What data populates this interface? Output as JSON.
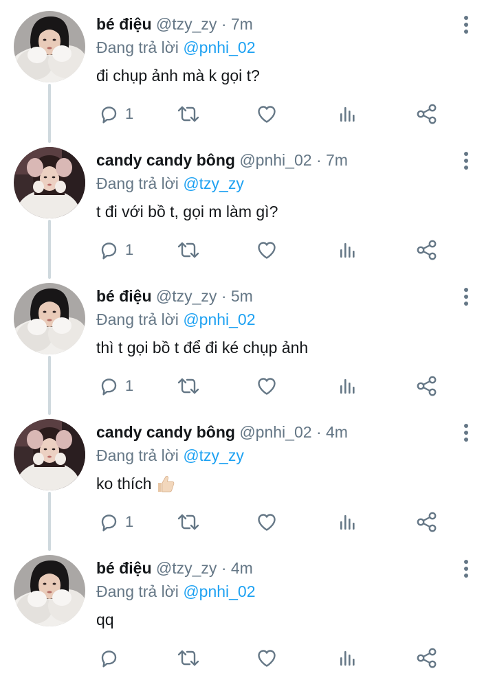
{
  "reply_prefix": "Đang trả lời",
  "tweets": [
    {
      "name": "bé điệu",
      "handle": "@tzy_zy",
      "dot": "·",
      "time": "7m",
      "reply_to": "@pnhi_02",
      "text": "đi chụp ảnh mà k gọi t?",
      "reply_count": "1",
      "avatar": "fur-girl",
      "emoji": ""
    },
    {
      "name": "candy candy bông",
      "handle": "@pnhi_02",
      "dot": "·",
      "time": "7m",
      "reply_to": "@tzy_zy",
      "text": "t đi với bồ t, gọi m làm gì?",
      "reply_count": "1",
      "avatar": "hoodie-girl",
      "emoji": ""
    },
    {
      "name": "bé điệu",
      "handle": "@tzy_zy",
      "dot": "·",
      "time": "5m",
      "reply_to": "@pnhi_02",
      "text": "thì t gọi bồ t để đi ké chụp ảnh",
      "reply_count": "1",
      "avatar": "fur-girl",
      "emoji": ""
    },
    {
      "name": "candy candy bông",
      "handle": "@pnhi_02",
      "dot": "·",
      "time": "4m",
      "reply_to": "@tzy_zy",
      "text": "ko thích",
      "reply_count": "1",
      "avatar": "hoodie-girl",
      "emoji": "thumbs-up"
    },
    {
      "name": "bé điệu",
      "handle": "@tzy_zy",
      "dot": "·",
      "time": "4m",
      "reply_to": "@pnhi_02",
      "text": "qq",
      "reply_count": "",
      "avatar": "fur-girl",
      "emoji": ""
    }
  ],
  "icons": {
    "reply": "reply-icon",
    "retweet": "retweet-icon",
    "like": "heart-icon",
    "stats": "analytics-icon",
    "share": "share-icon",
    "more": "more-vertical-icon"
  },
  "colors": {
    "text": "#14171a",
    "muted": "#657786",
    "link": "#1da1f2",
    "thread_line": "#cfd9de"
  }
}
